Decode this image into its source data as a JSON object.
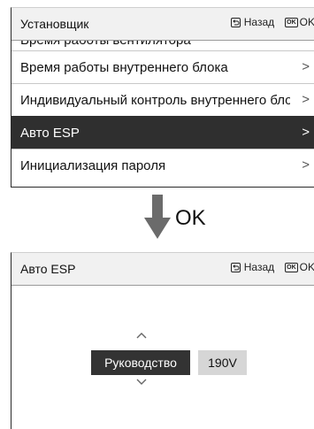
{
  "top_screen": {
    "header": {
      "title": "Установщик",
      "back_label": "Назад",
      "ok_icon": "OK",
      "ok_label": "OK"
    },
    "partial_item": "Время работы вентилятора",
    "items": [
      {
        "label": "Время работы внутреннего блока",
        "chevron": ">"
      },
      {
        "label": "Индивидуальный контроль внутреннего блока",
        "chevron": ">"
      },
      {
        "label": "Авто ESP",
        "chevron": ">",
        "selected": true
      },
      {
        "label": "Инициализация пароля",
        "chevron": ">"
      }
    ]
  },
  "transition": {
    "label": "OK"
  },
  "bottom_screen": {
    "header": {
      "title": "Авто ESP",
      "back_label": "Назад",
      "ok_icon": "OK",
      "ok_label": "OK"
    },
    "selector": {
      "selected": "Руководство",
      "value": "190V"
    }
  },
  "colors": {
    "selected_bg": "#2f2f2f",
    "header_bg": "#f1f1f1",
    "value_bg": "#d6d6d6",
    "arrow": "#6b6b6b"
  }
}
